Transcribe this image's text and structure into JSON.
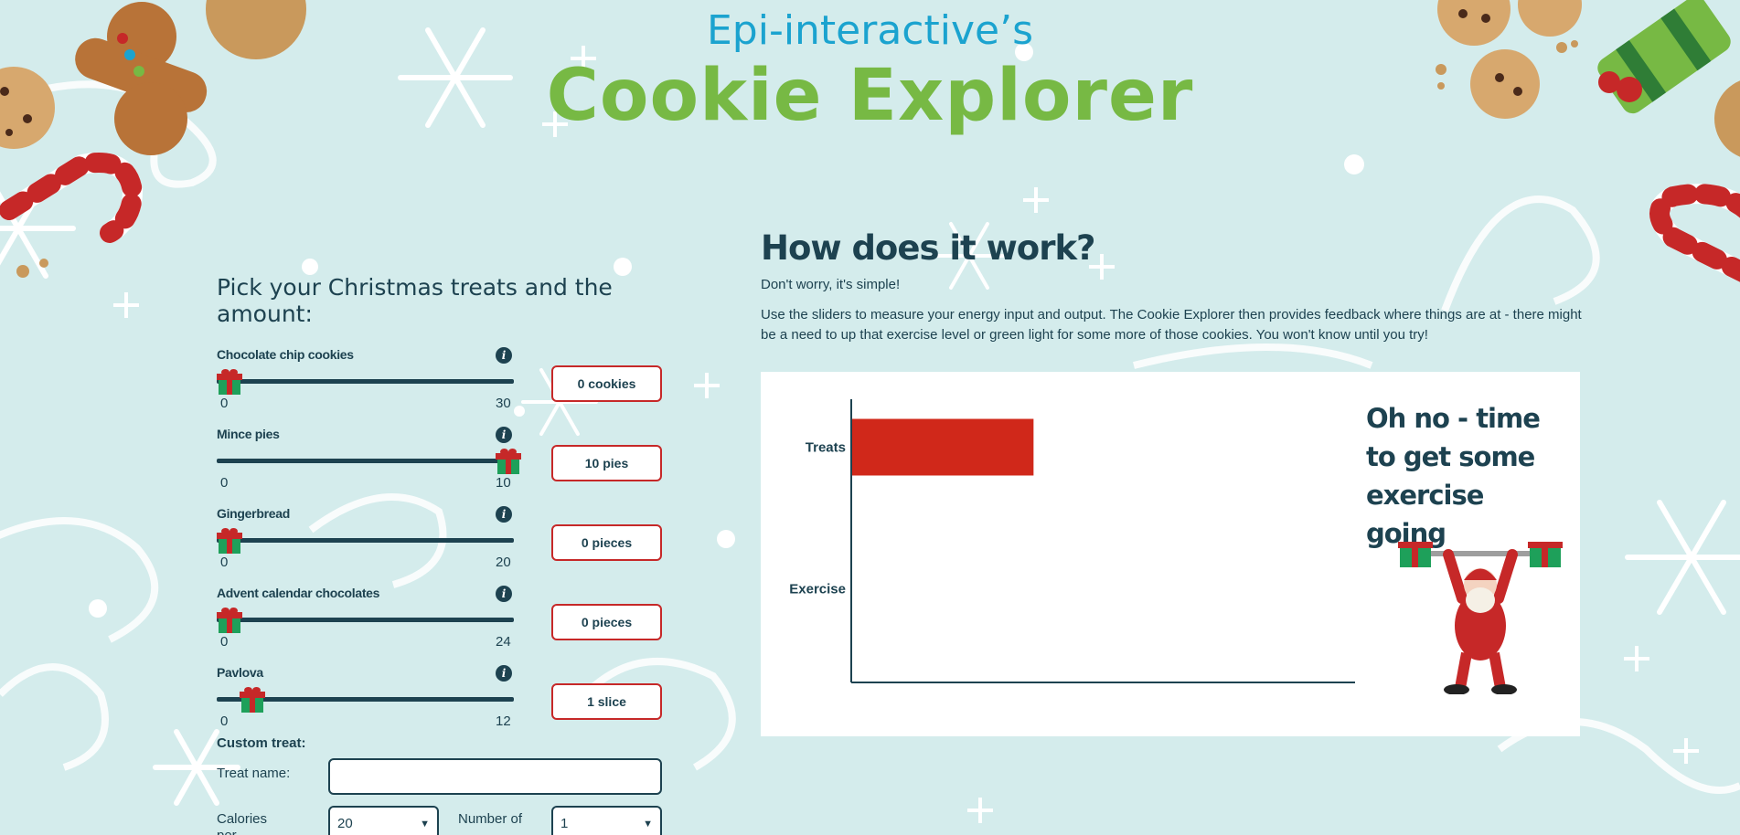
{
  "header": {
    "subtitle": "Epi-interactive’s",
    "brand": "Cookie Explorer"
  },
  "treats": {
    "title": "Pick your Christmas treats and the amount:",
    "items": [
      {
        "label": "Chocolate chip cookies",
        "min": "0",
        "max": "30",
        "value": 0,
        "range": 30,
        "display": "0 cookies"
      },
      {
        "label": "Mince pies",
        "min": "0",
        "max": "10",
        "value": 10,
        "range": 10,
        "display": "10 pies"
      },
      {
        "label": "Gingerbread",
        "min": "0",
        "max": "20",
        "value": 0,
        "range": 20,
        "display": "0 pieces"
      },
      {
        "label": "Advent calendar chocolates",
        "min": "0",
        "max": "24",
        "value": 0,
        "range": 24,
        "display": "0 pieces"
      },
      {
        "label": "Pavlova",
        "min": "0",
        "max": "12",
        "value": 1,
        "range": 12,
        "display": "1 slice"
      }
    ]
  },
  "custom": {
    "title": "Custom treat:",
    "name_label": "Treat name:",
    "name_value": "",
    "calories_label": "Calories per",
    "calories_value": "20",
    "number_label": "Number of",
    "number_value": "1"
  },
  "info": {
    "title": "How does it work?",
    "subtitle": "Don't worry, it's simple!",
    "description": "Use the sliders to measure your energy input and output. The Cookie Explorer then provides feedback where things are at - there might be a need to up that exercise level or green light for some more of those cookies. You won't know until you try!"
  },
  "chart_data": {
    "type": "bar",
    "orientation": "horizontal",
    "categories": [
      "Treats",
      "Exercise"
    ],
    "values": [
      36,
      0
    ],
    "xlim": [
      0,
      100
    ],
    "grid": false,
    "colors": [
      "#d0281a",
      "#d0281a"
    ]
  },
  "feedback": {
    "message": "Oh no - time to get some exercise going"
  },
  "icons": {
    "info": "info-icon",
    "slider_handle": "gift-icon",
    "santa": "santa-lifting-icon"
  }
}
